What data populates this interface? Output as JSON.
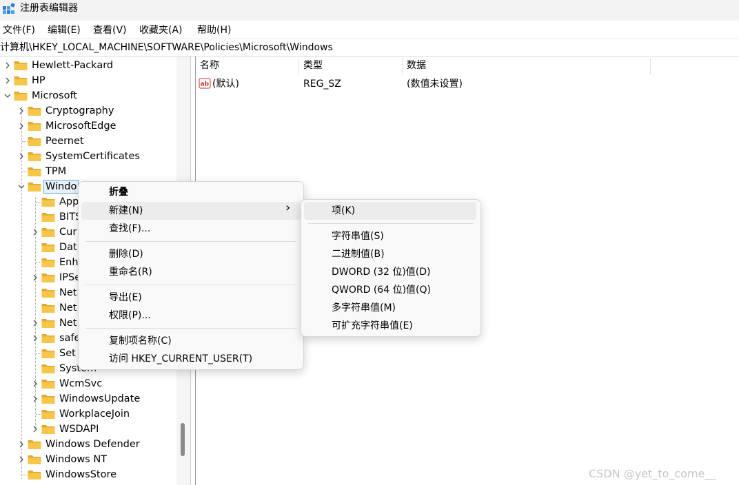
{
  "window": {
    "title": "注册表编辑器"
  },
  "menubar": {
    "items": [
      "文件(F)",
      "编辑(E)",
      "查看(V)",
      "收藏夹(A)",
      "帮助(H)"
    ]
  },
  "address": {
    "path": "计算机\\HKEY_LOCAL_MACHINE\\SOFTWARE\\Policies\\Microsoft\\Windows"
  },
  "tree": {
    "items": [
      "Hewlett-Packard",
      "HP",
      "Microsoft",
      "Cryptography",
      "MicrosoftEdge",
      "Peernet",
      "SystemCertificates",
      "TPM",
      "Windo",
      "App",
      "BITS",
      "Cur",
      "Dat",
      "Enh",
      "IPSe",
      "Net",
      "Net",
      "Net",
      "safe",
      "Set",
      "System",
      "WcmSvc",
      "WindowsUpdate",
      "WorkplaceJoin",
      "WSDAPI",
      "Windows Defender",
      "Windows NT",
      "WindowsStore"
    ]
  },
  "list": {
    "headers": [
      "名称",
      "类型",
      "数据"
    ],
    "rows": [
      {
        "name": "(默认)",
        "type": "REG_SZ",
        "data": "(数值未设置)"
      }
    ]
  },
  "context_menu": {
    "items": [
      "折叠",
      "新建(N)",
      "查找(F)...",
      "删除(D)",
      "重命名(R)",
      "导出(E)",
      "权限(P)...",
      "复制项名称(C)",
      "访问 HKEY_CURRENT_USER(T)"
    ],
    "submenu_arrow": "›"
  },
  "submenu": {
    "items": [
      "项(K)",
      "字符串值(S)",
      "二进制值(B)",
      "DWORD (32 位)值(D)",
      "QWORD (64 位)值(Q)",
      "多字符串值(M)",
      "可扩充字符串值(E)"
    ]
  },
  "watermark": "CSDN @yet_to_come__",
  "colors": {
    "folder": "#f5c64a",
    "folder_dark": "#e3a92c",
    "selection": "#e5f1fb",
    "menu_highlight": "#ececec"
  }
}
